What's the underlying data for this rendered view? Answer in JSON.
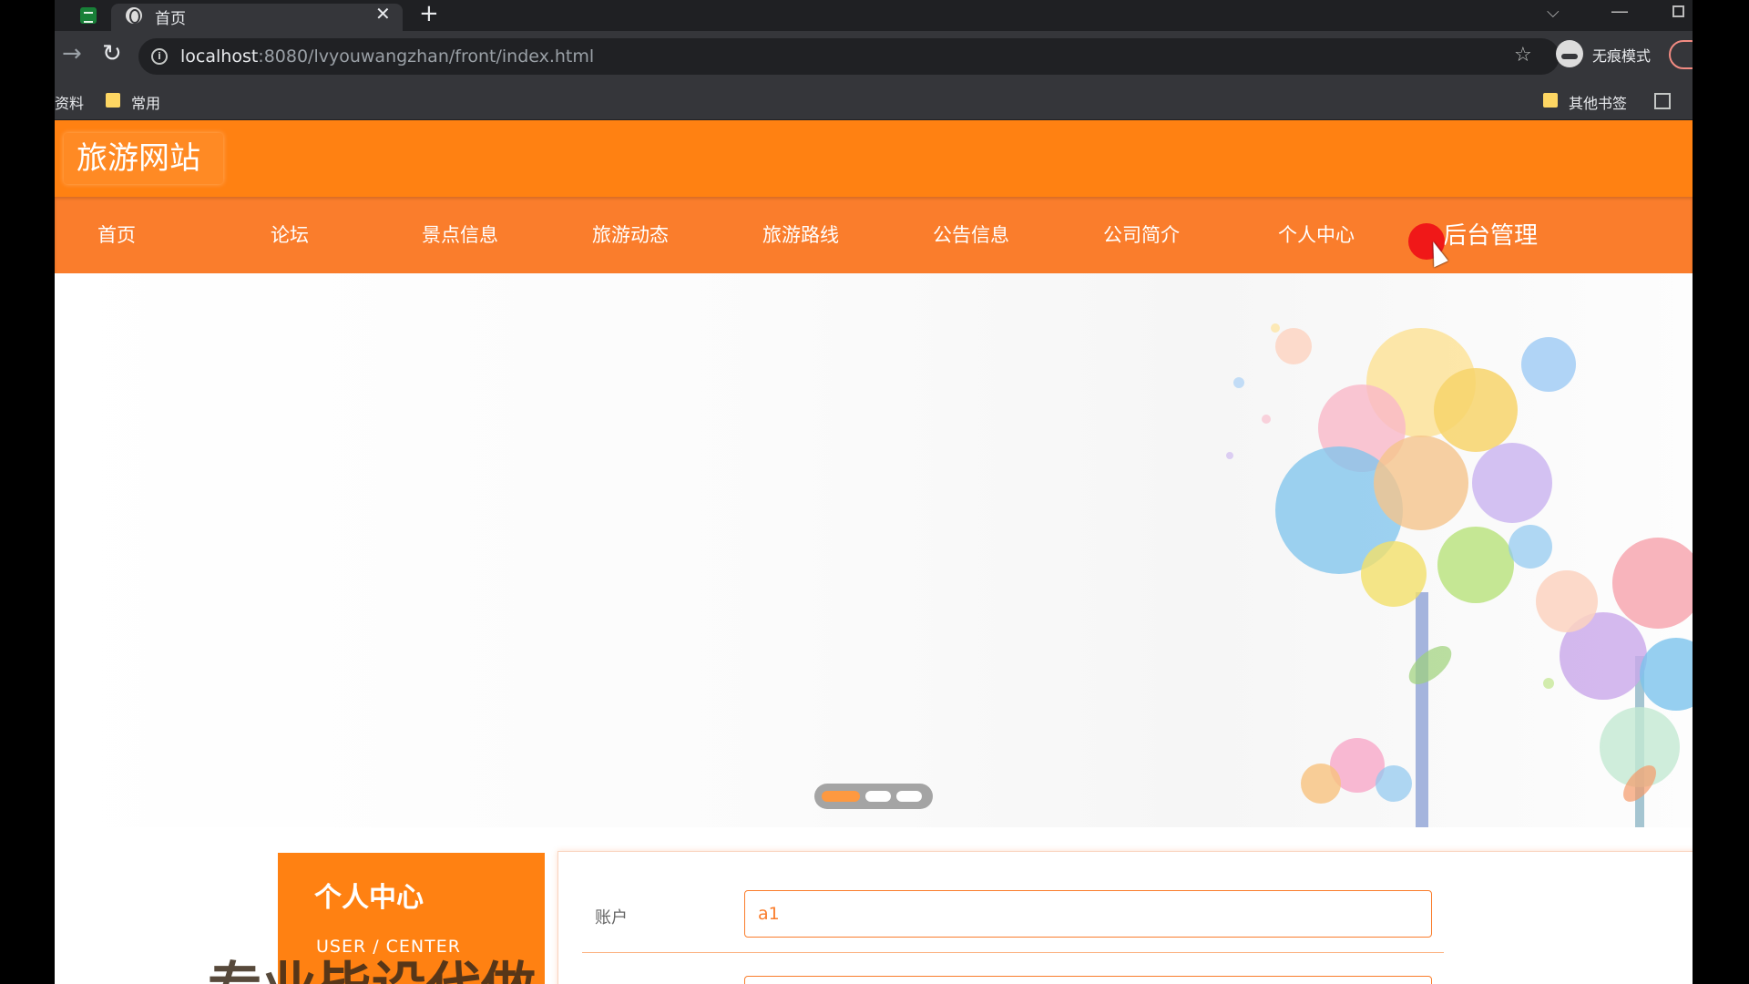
{
  "browser": {
    "tab_title": "首页",
    "url_host": "localhost",
    "url_path": ":8080/lvyouwangzhan/front/index.html",
    "incognito_label": "无痕模式",
    "bookmarks": [
      {
        "label": "资料"
      },
      {
        "label": "常用"
      }
    ],
    "other_bookmarks": "其他书签"
  },
  "site": {
    "logo": "旅游网站",
    "nav": [
      {
        "label": "首页"
      },
      {
        "label": "论坛"
      },
      {
        "label": "景点信息"
      },
      {
        "label": "旅游动态"
      },
      {
        "label": "旅游路线"
      },
      {
        "label": "公告信息"
      },
      {
        "label": "公司简介"
      },
      {
        "label": "个人中心"
      },
      {
        "label": "后台管理"
      }
    ],
    "carousel": {
      "slides": 3,
      "active": 0
    }
  },
  "user_center": {
    "title": "个人中心",
    "subtitle": "USER / CENTER",
    "caption": "专业毕设代做"
  },
  "form": {
    "account_label": "账户",
    "account_value": "a1"
  },
  "colors": {
    "brand_orange": "#ff8112",
    "nav_orange": "#fa7d2c"
  }
}
